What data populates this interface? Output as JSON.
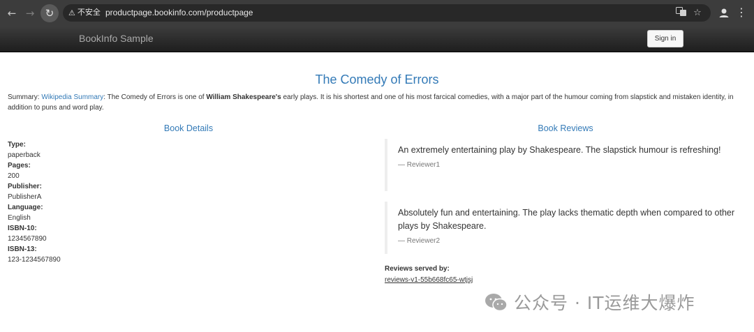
{
  "browser": {
    "security_label": "不安全",
    "url": "productpage.bookinfo.com/productpage"
  },
  "navbar": {
    "brand": "BookInfo Sample",
    "signin_label": "Sign in"
  },
  "page": {
    "title": "The Comedy of Errors",
    "summary": {
      "prefix": "Summary: ",
      "link": "Wikipedia Summary",
      "text1": ": The Comedy of Errors is one of ",
      "bold": "William Shakespeare's",
      "text2": " early plays. It is his shortest and one of his most farcical comedies, with a major part of the humour coming from slapstick and mistaken identity, in addition to puns and word play."
    }
  },
  "details": {
    "heading": "Book Details",
    "items": [
      {
        "label": "Type:",
        "value": "paperback"
      },
      {
        "label": "Pages:",
        "value": "200"
      },
      {
        "label": "Publisher:",
        "value": "PublisherA"
      },
      {
        "label": "Language:",
        "value": "English"
      },
      {
        "label": "ISBN-10:",
        "value": "1234567890"
      },
      {
        "label": "ISBN-13:",
        "value": "123-1234567890"
      }
    ]
  },
  "reviews": {
    "heading": "Book Reviews",
    "items": [
      {
        "text": "An extremely entertaining play by Shakespeare. The slapstick humour is refreshing!",
        "author": "— Reviewer1"
      },
      {
        "text": "Absolutely fun and entertaining. The play lacks thematic depth when compared to other plays by Shakespeare.",
        "author": "— Reviewer2"
      }
    ],
    "served_label": "Reviews served by:",
    "served_value": "reviews-v1-55b668fc65-wtjsj"
  },
  "watermark": {
    "text": "公众号 · IT运维大爆炸"
  },
  "colors": {
    "accent": "#337ab7",
    "navbar": "#2b2b2b",
    "chrome": "#3c3c3c"
  }
}
